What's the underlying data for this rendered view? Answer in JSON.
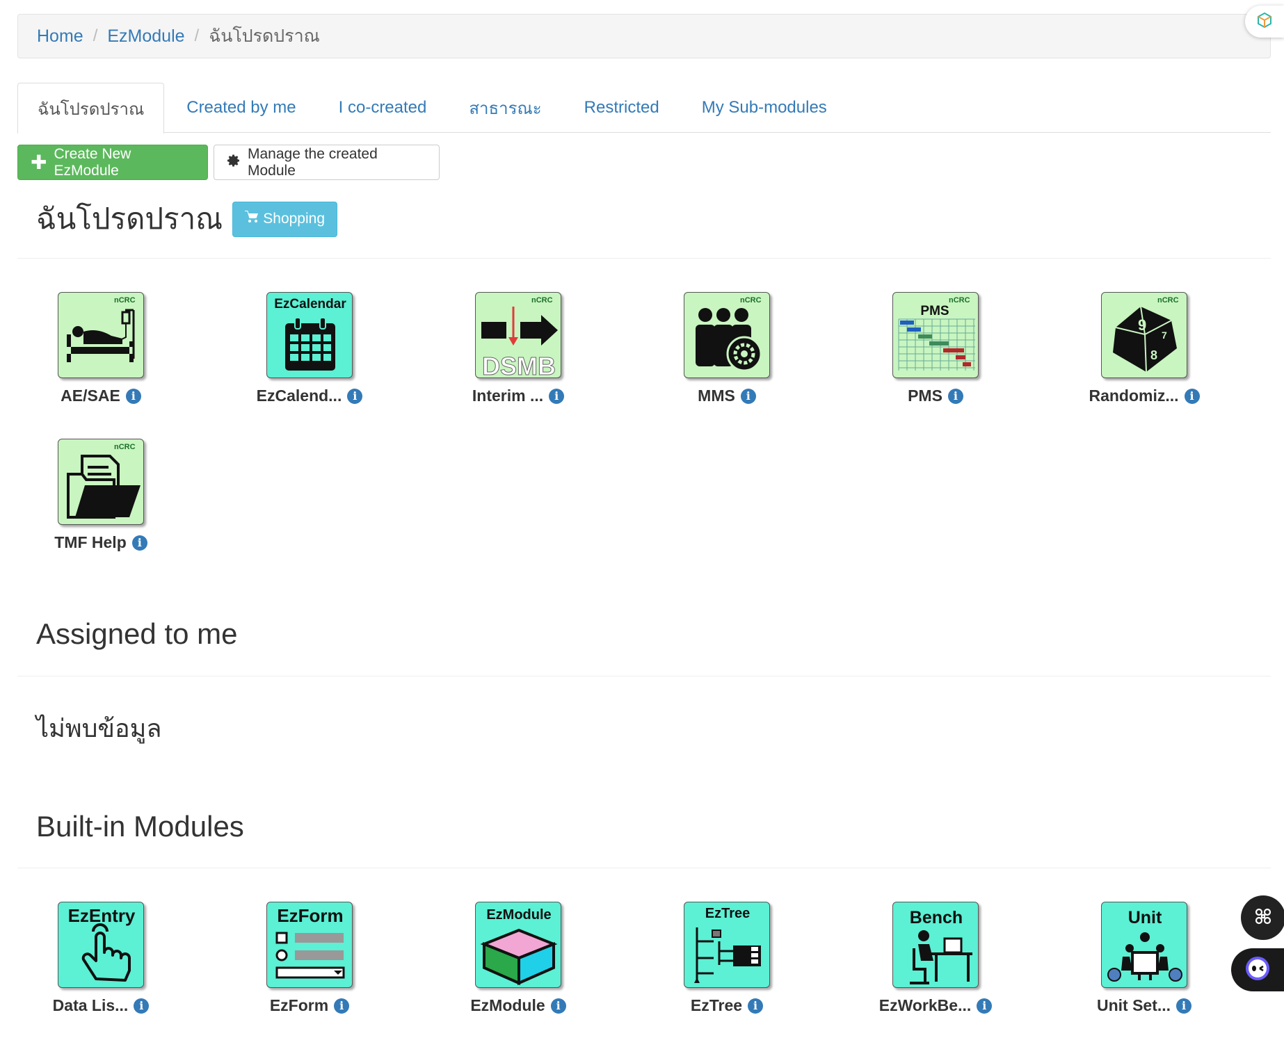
{
  "breadcrumb": {
    "home": "Home",
    "module": "EzModule",
    "current": "ฉันโปรดปราณ",
    "separator": "/"
  },
  "tabs": [
    {
      "label": "ฉันโปรดปราณ",
      "active": true
    },
    {
      "label": "Created by me",
      "active": false
    },
    {
      "label": "I co-created",
      "active": false
    },
    {
      "label": "สาธารณะ",
      "active": false
    },
    {
      "label": "Restricted",
      "active": false
    },
    {
      "label": "My Sub-modules",
      "active": false
    }
  ],
  "toolbar": {
    "create_label": "Create New EzModule",
    "manage_label": "Manage the created Module"
  },
  "favorites": {
    "title": "ฉันโปรดปราณ",
    "shopping_label": "Shopping",
    "modules": [
      {
        "label": "AE/SAE",
        "icon": "patient-bed-icon"
      },
      {
        "label": "EzCalend...",
        "icon": "calendar-icon",
        "icon_title": "EzCalendar"
      },
      {
        "label": "Interim ...",
        "icon": "dsmb-icon",
        "icon_title": "DSMB"
      },
      {
        "label": "MMS",
        "icon": "team-gear-icon"
      },
      {
        "label": "PMS",
        "icon": "gantt-chart-icon",
        "icon_title": "PMS"
      },
      {
        "label": "Randomiz...",
        "icon": "dice-icon"
      },
      {
        "label": "TMF Help",
        "icon": "folder-documents-icon"
      }
    ],
    "badge": "nCRC"
  },
  "assigned": {
    "title": "Assigned to me",
    "empty_text": "ไม่พบข้อมูล"
  },
  "builtin": {
    "title": "Built-in Modules",
    "modules": [
      {
        "label": "Data Lis...",
        "icon": "tap-hand-icon",
        "icon_title": "EzEntry"
      },
      {
        "label": "EzForm",
        "icon": "form-icon",
        "icon_title": "EzForm"
      },
      {
        "label": "EzModule",
        "icon": "box-icon",
        "icon_title": "EzModule"
      },
      {
        "label": "EzTree",
        "icon": "tree-icon",
        "icon_title": "EzTree"
      },
      {
        "label": "EzWorkBe...",
        "icon": "workbench-icon",
        "icon_title": "Bench"
      },
      {
        "label": "Unit Set...",
        "icon": "unit-team-icon",
        "icon_title": "Unit"
      }
    ]
  },
  "colors": {
    "link": "#337ab7",
    "success": "#5cb85c",
    "info": "#5bc0de",
    "favorite_icon_bg": "#c9f5c0",
    "builtin_icon_bg": "#5cf0d4"
  }
}
